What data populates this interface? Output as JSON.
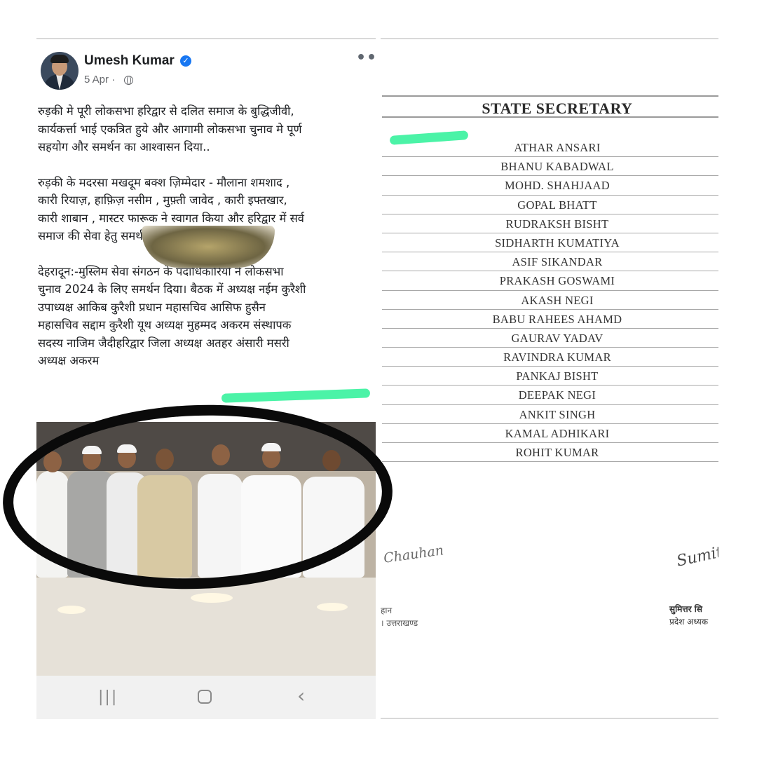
{
  "post": {
    "author": "Umesh Kumar",
    "date": "5 Apr ·",
    "more_label": "•••",
    "paragraphs": [
      "रुड़की मे पूरी लोकसभा हरिद्वार से दलित समाज के बुद्धिजीवी,\nकार्यकर्त्ता भाई एकत्रित हुये और आगामी लोकसभा चुनाव मे पूर्ण\nसहयोग और समर्थन का आश्वासन दिया..",
      "रुड़की के मदरसा मखदूम बक्श  ज़िम्मेदार - मौलाना शमशाद ,\nकारी रियाज़, हाफ़िज़ नसीम , मुफ़्ती जावेद , कारी इफ्तखार,\nकारी शाबान , मास्टर फारूक ने स्वागत किया और हरिद्वार में सर्व\nसमाज की सेवा हेतु समर्थन दिया।",
      "देहरादून:-मुस्लिम सेवा संगठन के पदाधिकारियों ने लोकसभा\nचुनाव 2024 के लिए समर्थन दिया। बैठक में अध्यक्ष नईम कुरैशी\nउपाध्यक्ष आकिब कुरैशी प्रधान महासचिव आसिफ हुसैन\nमहासचिव सद्दाम कुरैशी यूथ अध्यक्ष मुहम्मद अकरम संस्थापक\nसदस्य नाजिम जैदीहरिद्वार जिला अध्यक्ष अतहर अंसारी मसरी\nअध्यक्ष अकरम"
    ]
  },
  "nav": {
    "recent": "|||",
    "back": "‹"
  },
  "document": {
    "title": "STATE SECRETARY",
    "names": [
      "ATHAR ANSARI",
      "BHANU KABADWAL",
      "MOHD. SHAHJAAD",
      "GOPAL BHATT",
      "RUDRAKSH BISHT",
      "SIDHARTH KUMATIYA",
      "ASIF SIKANDAR",
      "PRAKASH GOSWAMI",
      "AKASH NEGI",
      "BABU RAHEES AHAMD",
      "GAURAV YADAV",
      "RAVINDRA KUMAR",
      "PANKAJ BISHT",
      "DEEPAK NEGI",
      "ANKIT SINGH",
      "KAMAL ADHIKARI",
      "ROHIT KUMAR"
    ],
    "signature_left": "Chauhan",
    "signature_left_sub1": "हान",
    "signature_left_sub2": "। उत्तराखण्ड",
    "signature_right": "Sumit",
    "signature_right_sub1": "सुमित्तर सि",
    "signature_right_sub2": "प्रदेश अध्यक"
  },
  "colors": {
    "highlight": "#3cf2a0",
    "circle": "#0a0a0a",
    "verified": "#1877f2"
  },
  "icons": [
    "verified-icon",
    "globe-icon",
    "more-icon",
    "nav-recent-icon",
    "nav-home-icon",
    "nav-back-icon"
  ]
}
